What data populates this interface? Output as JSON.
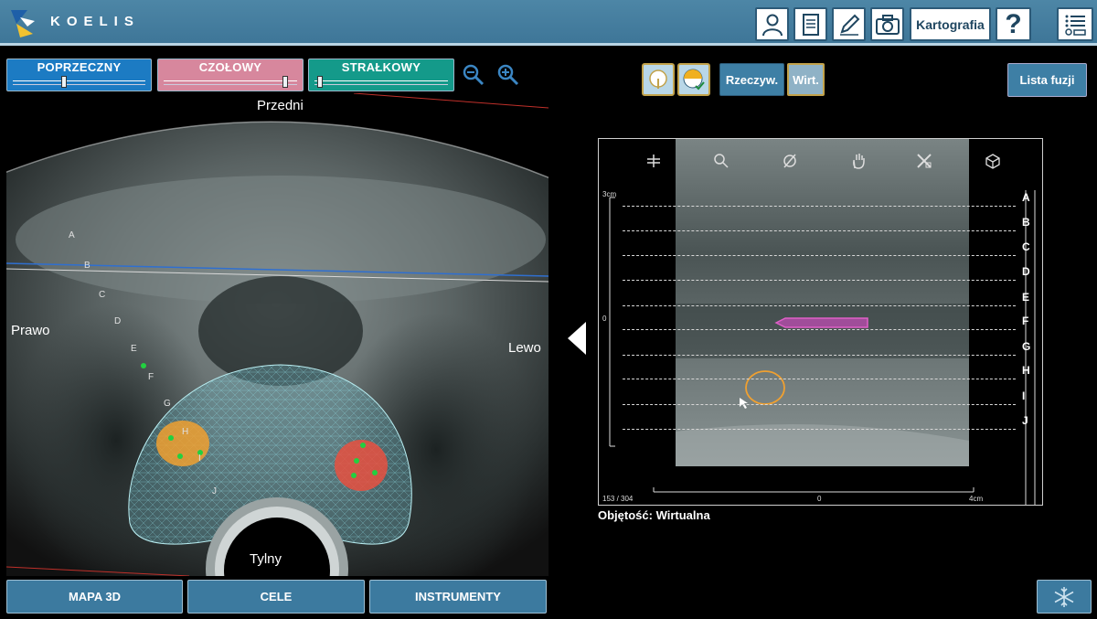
{
  "app": {
    "logo_text": "KOELIS"
  },
  "toolbar": {
    "kartografia_label": "Kartografia",
    "help_label": "?"
  },
  "modes": {
    "poprzeczny": {
      "label": "POPRZECZNY",
      "slider_fraction": 0.38
    },
    "czolowy": {
      "label": "CZOŁOWY",
      "slider_fraction": 0.93
    },
    "strzalkowy": {
      "label": "STRAŁKOWY",
      "slider_fraction": 0.02
    }
  },
  "left_view": {
    "orientation": {
      "top": "Przedni",
      "bottom": "Tylny",
      "left": "Prawo",
      "right": "Lewo"
    },
    "row_markers": [
      "A",
      "B",
      "C",
      "D",
      "E",
      "F",
      "G",
      "H",
      "I",
      "J"
    ]
  },
  "right_panel": {
    "rzeczyw_label": "Rzeczyw.",
    "wirt_label": "Wirt.",
    "lista_fuzji_label": "Lista fuzji",
    "frame_counter": "153 / 304",
    "scale_top": "3cm",
    "scale_zero_y": "0",
    "scale_zero_x": "0",
    "scale_right": "4cm",
    "rows": [
      "A",
      "B",
      "C",
      "D",
      "E",
      "F",
      "G",
      "H",
      "I",
      "J"
    ],
    "volume_label": "Objętość: Wirtualna"
  },
  "bottom": {
    "mapa3d_label": "MAPA 3D",
    "cele_label": "CELE",
    "instrumenty_label": "INSTRUMENTY"
  },
  "colors": {
    "topbar": "#4580a2",
    "poprzeczny": "#1c7bc3",
    "czolowy": "#d7879d",
    "strzalkowy": "#149a8a",
    "target_orange": "#f0a030",
    "target_red": "#e85040",
    "needle_pink": "#e060c8"
  }
}
